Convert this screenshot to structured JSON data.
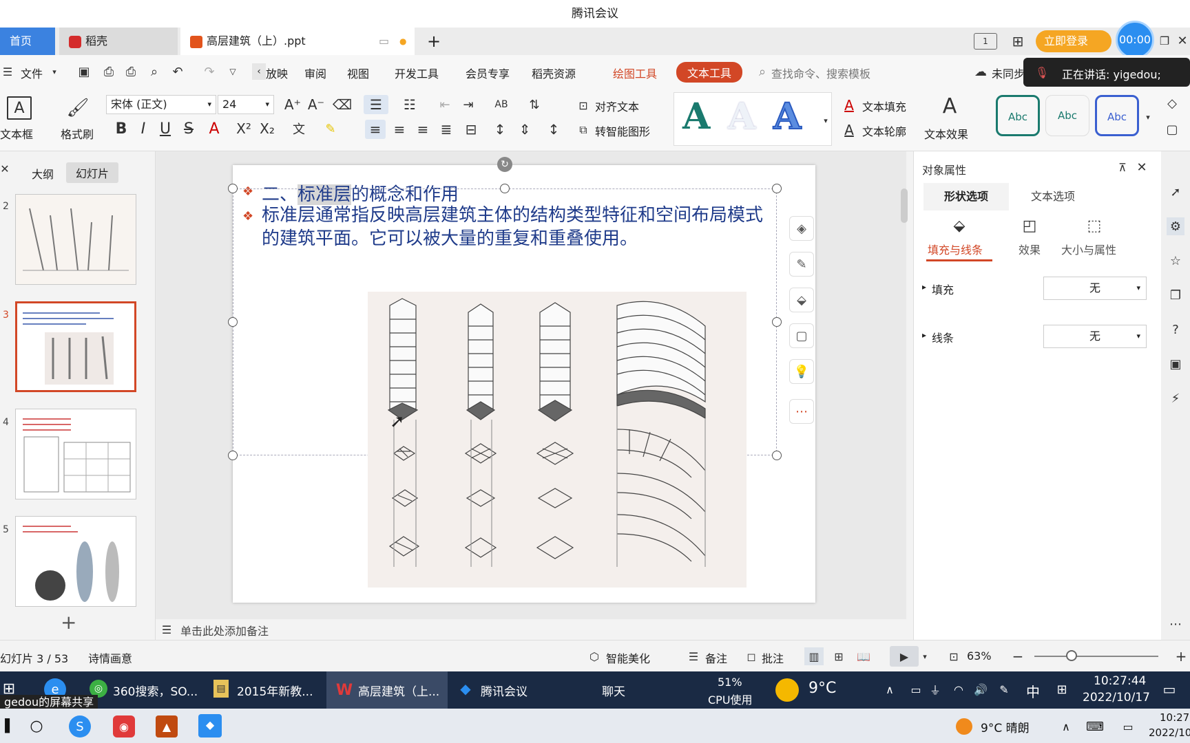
{
  "window_title": "腾讯会议",
  "tabs": {
    "home": "首页",
    "daoke": "稻壳",
    "doc": "高层建筑（上）.ppt",
    "new_tab": "+"
  },
  "header_right": {
    "login": "立即登录",
    "timer": "00:00",
    "speaking": "正在讲话: yigedou;",
    "sync": "未同步"
  },
  "menu": {
    "file": "文件",
    "items": [
      "放映",
      "审阅",
      "视图",
      "开发工具",
      "会员专享",
      "稻壳资源"
    ],
    "drawing_tools": "绘图工具",
    "text_tools": "文本工具",
    "search_placeholder": "查找命令、搜索模板"
  },
  "ribbon": {
    "textbox": "文本框",
    "format_painter": "格式刷",
    "font": "宋体 (正文)",
    "size": "24",
    "align_text": "对齐文本",
    "smart_shape": "转智能图形",
    "text_fill": "文本填充",
    "text_outline": "文本轮廓",
    "text_effect": "文本效果",
    "styles": [
      "Abc",
      "Abc",
      "Abc"
    ]
  },
  "left_panel": {
    "outline_tab": "大纲",
    "slides_tab": "幻灯片",
    "slide_numbers": [
      "2",
      "3",
      "4",
      "5"
    ],
    "add": "+"
  },
  "slide": {
    "title_prefix": "二、",
    "title_highlight": "标准层",
    "title_suffix": "的概念和作用",
    "body": "标准层通常指反映高层建筑主体的结构类型特征和空间布局模式的建筑平面。它可以被大量的重复和重叠使用。",
    "bullet": "❖"
  },
  "notes_placeholder": "单击此处添加备注",
  "right_panel": {
    "title": "对象属性",
    "tab_shape": "形状选项",
    "tab_text": "文本选项",
    "sub_fill_line": "填充与线条",
    "sub_effect": "效果",
    "sub_size": "大小与属性",
    "fill_label": "填充",
    "fill_value": "无",
    "line_label": "线条",
    "line_value": "无"
  },
  "status": {
    "slide_counter": "幻灯片 3 / 53",
    "theme": "诗情画意",
    "beautify": "智能美化",
    "notes": "备注",
    "comment": "批注",
    "zoom": "63%"
  },
  "taskbar": {
    "items": [
      "360搜索，SO...",
      "2015年新教...",
      "高层建筑（上...",
      "腾讯会议",
      "聊天"
    ],
    "cpu_pct": "51%",
    "cpu_label": "CPU使用",
    "temp": "9°C",
    "ime": "中",
    "time": "10:27:44",
    "date": "2022/10/17",
    "share_label": "gedou的屏幕共享"
  },
  "taskbar2": {
    "weather": "9°C  晴朗",
    "time": "10:27",
    "date": "2022/10"
  },
  "colors": {
    "accent_orange": "#d24726",
    "wps_blue": "#2b6fd6",
    "slide_text": "#1f3b8a",
    "style_teal": "#1a7a6e"
  }
}
